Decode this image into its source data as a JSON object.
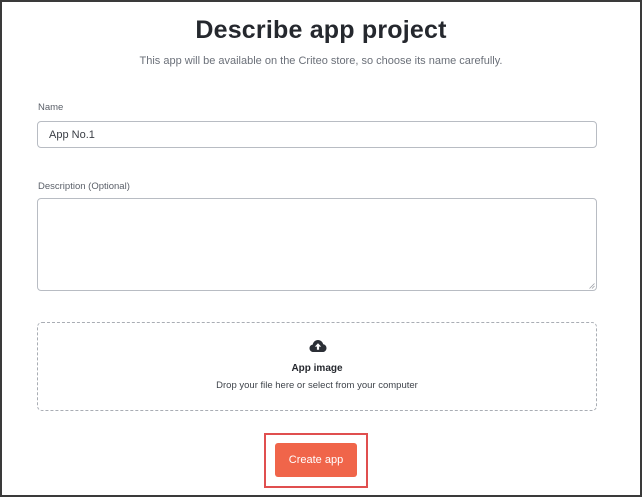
{
  "header": {
    "title": "Describe app project",
    "subtitle": "This app will be available on the Criteo store, so choose its name carefully."
  },
  "form": {
    "name": {
      "label": "Name",
      "value": "App No.1"
    },
    "description": {
      "label": "Description (Optional)",
      "value": ""
    },
    "app_image": {
      "icon": "cloud-upload-icon",
      "title": "App image",
      "hint": "Drop your file here or select from your computer"
    },
    "submit": {
      "label": "Create app"
    }
  },
  "colors": {
    "accent": "#f0654a",
    "highlight_border": "#e04f4f",
    "text_primary": "#25282e",
    "border": "#b8bcc3"
  }
}
